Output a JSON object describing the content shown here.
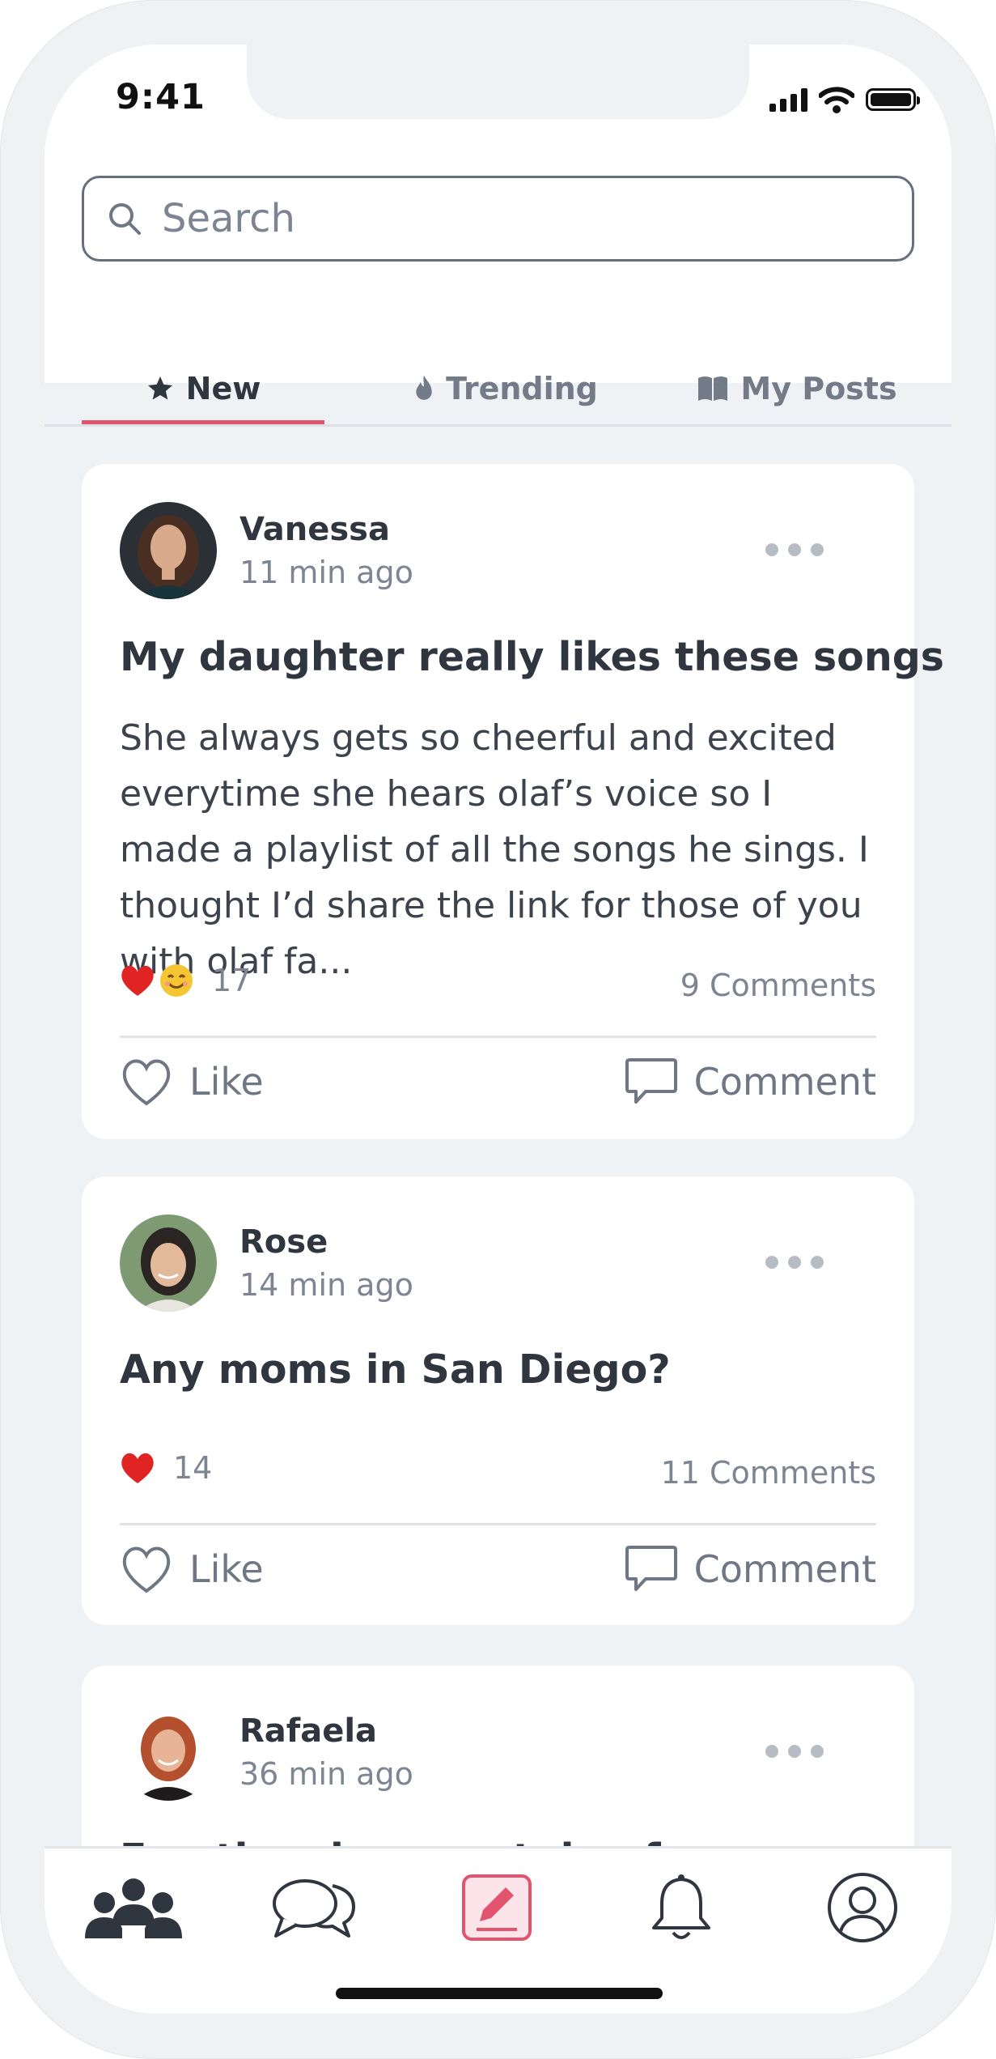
{
  "status_bar": {
    "time": "9:41"
  },
  "search": {
    "placeholder": "Search",
    "value": ""
  },
  "tabs": [
    {
      "label": "New",
      "icon": "star-icon",
      "active": true
    },
    {
      "label": "Trending",
      "icon": "flame-icon",
      "active": false
    },
    {
      "label": "My Posts",
      "icon": "book-icon",
      "active": false
    }
  ],
  "posts": [
    {
      "author": "Vanessa",
      "time": "11 min ago",
      "title": "My daughter really likes these songs",
      "body": "She always gets so cheerful and excited everytime she hears olaf’s voice so I made a playlist of all the songs he sings. I thought I’d share the link for those of you with olaf fa...",
      "reactions": [
        "heart",
        "smile"
      ],
      "reaction_count": "17",
      "comments": "9 Comments",
      "like_label": "Like",
      "comment_label": "Comment"
    },
    {
      "author": "Rose",
      "time": "14 min ago",
      "title": "Any moms in San Diego?",
      "reactions": [
        "heart"
      ],
      "reaction_count": "14",
      "comments": "11 Comments",
      "like_label": "Like",
      "comment_label": "Comment"
    },
    {
      "author": "Rafaela",
      "time": "36 min ago",
      "title": "Emotional support dog for my son"
    }
  ],
  "bottom_nav": [
    {
      "icon": "community-icon",
      "active": true
    },
    {
      "icon": "chat-icon",
      "active": false
    },
    {
      "icon": "compose-icon",
      "active": false
    },
    {
      "icon": "bell-icon",
      "active": false
    },
    {
      "icon": "profile-icon",
      "active": false
    }
  ],
  "colors": {
    "accent": "#e3556f",
    "text": "#2f3640",
    "muted": "#7c8591",
    "background": "#eff2f5"
  }
}
